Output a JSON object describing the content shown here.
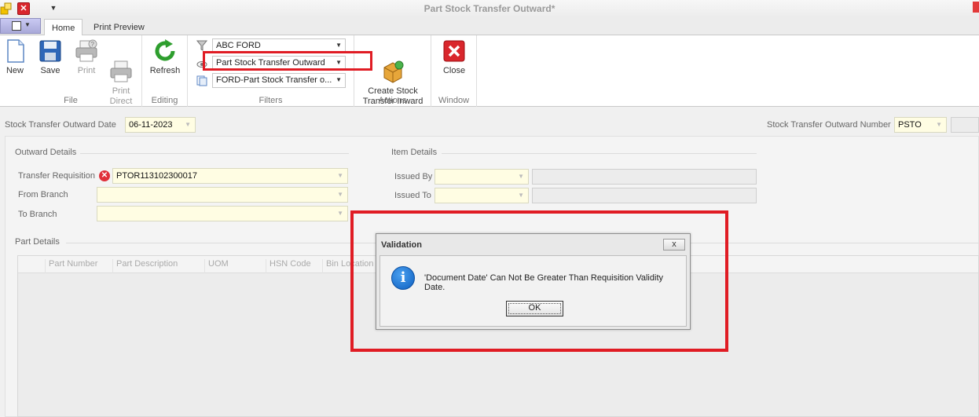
{
  "window": {
    "title": "Part Stock Transfer Outward*"
  },
  "ribbon": {
    "tabs": [
      {
        "label": "Home"
      },
      {
        "label": "Print Preview"
      }
    ],
    "groups": {
      "file": {
        "label": "File",
        "new": "New",
        "save": "Save",
        "print": "Print",
        "print_direct": "Print\nDirect"
      },
      "editing": {
        "label": "Editing",
        "refresh": "Refresh"
      },
      "filters": {
        "label": "Filters",
        "company": "ABC FORD",
        "document_type": "Part Stock Transfer Outward",
        "series": "FORD-Part Stock Transfer o..."
      },
      "actions": {
        "label": "Actions",
        "create_inward": "Create Stock\nTransfer Inward"
      },
      "window": {
        "label": "Window",
        "close": "Close"
      }
    }
  },
  "header": {
    "date_label": "Stock Transfer Outward Date",
    "date_value": "06-11-2023",
    "number_label": "Stock Transfer Outward Number",
    "number_prefix": "PSTO"
  },
  "outward": {
    "section_title": "Outward Details",
    "requisition_label": "Transfer Requisition",
    "requisition_value": "PTOR113102300017",
    "from_branch_label": "From Branch",
    "to_branch_label": "To Branch"
  },
  "item": {
    "section_title": "Item Details",
    "issued_by_label": "Issued By",
    "issued_to_label": "Issued To"
  },
  "parts": {
    "section_title": "Part Details",
    "columns": [
      "Part Number",
      "Part Description",
      "UOM",
      "HSN Code",
      "Bin Location"
    ]
  },
  "dialog": {
    "title": "Validation",
    "close": "x",
    "message": "'Document Date' Can Not Be Greater Than Requisition Validity Date.",
    "ok": "OK",
    "info_glyph": "i"
  },
  "colors": {
    "highlight": "#e01c24",
    "input_bg": "#fffde3",
    "info_blue": "#1a73d9"
  }
}
